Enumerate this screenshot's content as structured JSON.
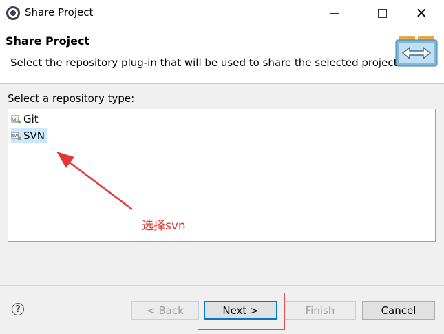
{
  "window": {
    "title": "Share Project"
  },
  "header": {
    "title": "Share Project",
    "description": "Select the repository plug-in that will be used to share the selected project."
  },
  "repository": {
    "label": "Select a repository type:",
    "items": [
      {
        "label": "Git",
        "icon": "git-plugin-icon",
        "selected": false
      },
      {
        "label": "SVN",
        "icon": "svn-plugin-icon",
        "selected": true
      }
    ]
  },
  "annotation": {
    "text": "选择svn",
    "color": "#e53535"
  },
  "buttons": {
    "back": "< Back",
    "next": "Next >",
    "finish": "Finish",
    "cancel": "Cancel"
  },
  "colors": {
    "selection": "#cce8ff",
    "default_button_border": "#0078d7",
    "annotation": "#e53535"
  }
}
